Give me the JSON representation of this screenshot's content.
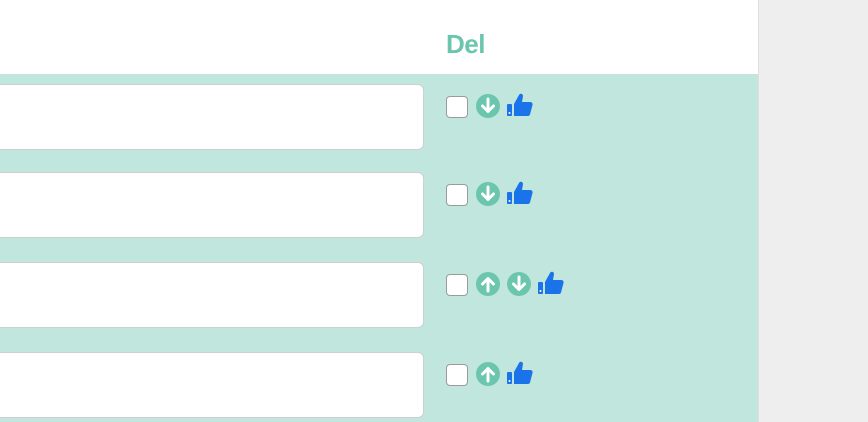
{
  "header": {
    "title": "Del"
  },
  "rows": [
    {
      "text": "",
      "checked": false,
      "has_up": false,
      "has_down": true
    },
    {
      "text": "",
      "checked": false,
      "has_up": false,
      "has_down": true
    },
    {
      "text": "",
      "checked": false,
      "has_up": true,
      "has_down": true
    },
    {
      "text": "",
      "checked": false,
      "has_up": true,
      "has_down": false
    }
  ],
  "icons": {
    "move_up": "arrow-up-circle-icon",
    "move_down": "arrow-down-circle-icon",
    "like": "thumbs-up-icon"
  },
  "colors": {
    "accent": "#6cc6ad",
    "row_background": "#c0e6de",
    "arrow": "#6cc6ad",
    "like": "#1a73e8",
    "page_background": "#eeeeee"
  }
}
